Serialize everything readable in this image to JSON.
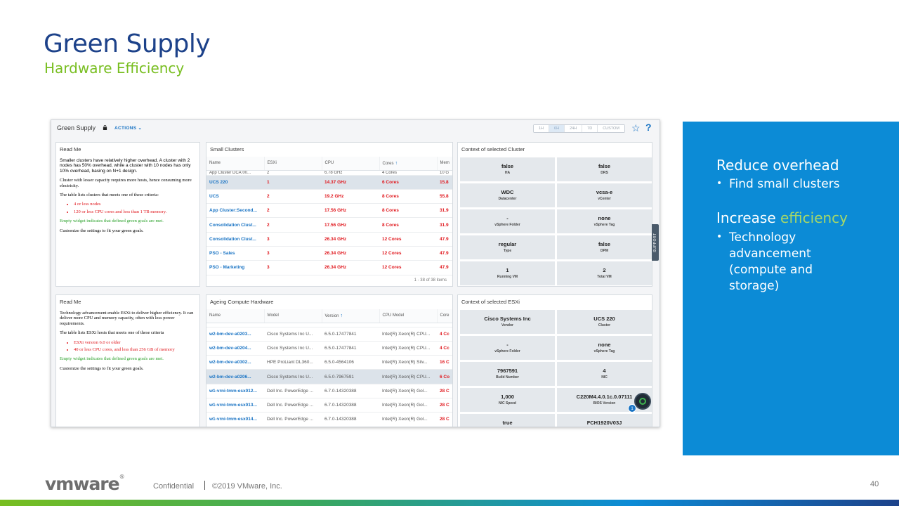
{
  "slide": {
    "title": "Green Supply",
    "subtitle": "Hardware Efficiency",
    "page_number": "40"
  },
  "dashboard": {
    "title": "Green Supply",
    "actions_label": "ACTIONS",
    "time_tabs": [
      "1H",
      "6H",
      "24H",
      "7D",
      "CUSTOM"
    ],
    "active_time_tab": "6H",
    "support_label": "SUPPORT",
    "fab_badge": "1"
  },
  "readme1": {
    "title": "Read Me",
    "p1": "Smaller clusters have relatively higher overhead. A cluster with 2 nodes has 50% overhead, while a cluster with 10 nodes has only 10% overhead, basing on N+1 design.",
    "p2": "Cluster with lesser capacity requires more hosts, hence consuming more electricity.",
    "p3": "The table lists clusters that meets one of these criteria:",
    "bullets": [
      "4 or less nodes",
      "120 or less CPU cores and less than 1 TB memory."
    ],
    "p4": "Empty widget indicates that defined green goals are met.",
    "p5": "Customize the settings to fit your green goals."
  },
  "readme2": {
    "title": "Read Me",
    "p1": "Technology advancement enable ESXi to deliver higher efficiency. It can deliver more CPU and memory capacity, often with less power requirements.",
    "p3": "The table lists ESXi hosts that meets one of these criteria",
    "bullets": [
      "ESXi version 6.0 or older",
      "40 or less CPU cores, and less than 256 GB of memory"
    ],
    "p4": "Empty widget indicates that defined green goals are met.",
    "p5": "Customize the settings to fit your green goals."
  },
  "small_clusters": {
    "title": "Small Clusters",
    "columns": [
      "Name",
      "ESXi",
      "CPU",
      "Cores",
      "Mem"
    ],
    "partial_row": [
      "App Cluster DCA:00...",
      "2",
      "6.78 GHz",
      "4 Cores",
      "10 G"
    ],
    "rows": [
      [
        "UCS 220",
        "1",
        "14.37 GHz",
        "6 Cores",
        "15.8"
      ],
      [
        "UCS",
        "2",
        "19.2 GHz",
        "8 Cores",
        "55.8"
      ],
      [
        "App Cluster:Second...",
        "2",
        "17.56 GHz",
        "8 Cores",
        "31.9"
      ],
      [
        "Consolidation Clust...",
        "2",
        "17.56 GHz",
        "8 Cores",
        "31.9"
      ],
      [
        "Consolidation Clust...",
        "3",
        "26.34 GHz",
        "12 Cores",
        "47.9"
      ],
      [
        "PSO - Sales",
        "3",
        "26.34 GHz",
        "12 Cores",
        "47.9"
      ],
      [
        "PSO - Marketing",
        "3",
        "26.34 GHz",
        "12 Cores",
        "47.9"
      ]
    ],
    "pager": "1 - 38 of 38 items"
  },
  "ageing_hardware": {
    "title": "Ageing Compute Hardware",
    "columns": [
      "Name",
      "Model",
      "Version",
      "CPU Model",
      "Core"
    ],
    "rows": [
      [
        "w2-bm-dev-a0203...",
        "Cisco Systems Inc U...",
        "6.5.0-17477841",
        "Intel(R) Xeon(R) CPU...",
        "4 Cc"
      ],
      [
        "w2-bm-dev-a0204...",
        "Cisco Systems Inc U...",
        "6.5.0-17477841",
        "Intel(R) Xeon(R) CPU...",
        "4 Cc"
      ],
      [
        "w2-bm-dev-a0302...",
        "HPE ProLiant DL360...",
        "6.5.0-4564106",
        "Intel(R) Xeon(R) Silv...",
        "16 C"
      ],
      [
        "w2-bm-dev-a0206...",
        "Cisco Systems Inc U...",
        "6.5.0-7967591",
        "Intel(R) Xeon(R) CPU...",
        "6 Co"
      ],
      [
        "w1-vrni-tmm-esx012...",
        "Dell Inc. PowerEdge ...",
        "6.7.0-14320388",
        "Intel(R) Xeon(R) Gol...",
        "28 C"
      ],
      [
        "w1-vrni-tmm-esx013...",
        "Dell Inc. PowerEdge ...",
        "6.7.0-14320388",
        "Intel(R) Xeon(R) Gol...",
        "28 C"
      ],
      [
        "w1-vrni-tmm-esx014...",
        "Dell Inc. PowerEdge ...",
        "6.7.0-14320388",
        "Intel(R) Xeon(R) Gol...",
        "28 C"
      ]
    ]
  },
  "ctx_cluster": {
    "title": "Context of selected Cluster",
    "cells": [
      {
        "value": "false",
        "label": "HA"
      },
      {
        "value": "false",
        "label": "DRS"
      },
      {
        "value": "WDC",
        "label": "Datacenter"
      },
      {
        "value": "vcsa-e",
        "label": "vCenter"
      },
      {
        "value": "-",
        "label": "vSphere Folder"
      },
      {
        "value": "none",
        "label": "vSphere Tag"
      },
      {
        "value": "regular",
        "label": "Type"
      },
      {
        "value": "false",
        "label": "DPM"
      },
      {
        "value": "1",
        "label": "Running VM"
      },
      {
        "value": "2",
        "label": "Total VM"
      }
    ]
  },
  "ctx_esxi": {
    "title": "Context of selected ESXi",
    "cells": [
      {
        "value": "Cisco Systems Inc",
        "label": "Vendor"
      },
      {
        "value": "UCS 220",
        "label": "Cluster"
      },
      {
        "value": "-",
        "label": "vSphere Folder"
      },
      {
        "value": "none",
        "label": "vSphere Tag"
      },
      {
        "value": "7967591",
        "label": "Build Number"
      },
      {
        "value": "4",
        "label": "NIC"
      },
      {
        "value": "1,000",
        "label": "NIC Speed"
      },
      {
        "value": "C220M4.4.0.1c.0.07111",
        "label": "BIOS Version"
      },
      {
        "value": "true",
        "label": ""
      },
      {
        "value": "FCH1920V03J",
        "label": ""
      }
    ]
  },
  "sidebar": {
    "h1": "Reduce overhead",
    "b1": "Find small clusters",
    "h2_pre": "Increase ",
    "h2_acc": "efficiency",
    "b2": "Technology advancement (compute and storage)",
    "accent_color": "#a7d867",
    "bg_color": "#0c8bd6"
  },
  "footer": {
    "logo": "vmware",
    "confidential": "Confidential",
    "copyright": "©2019 VMware, Inc."
  }
}
